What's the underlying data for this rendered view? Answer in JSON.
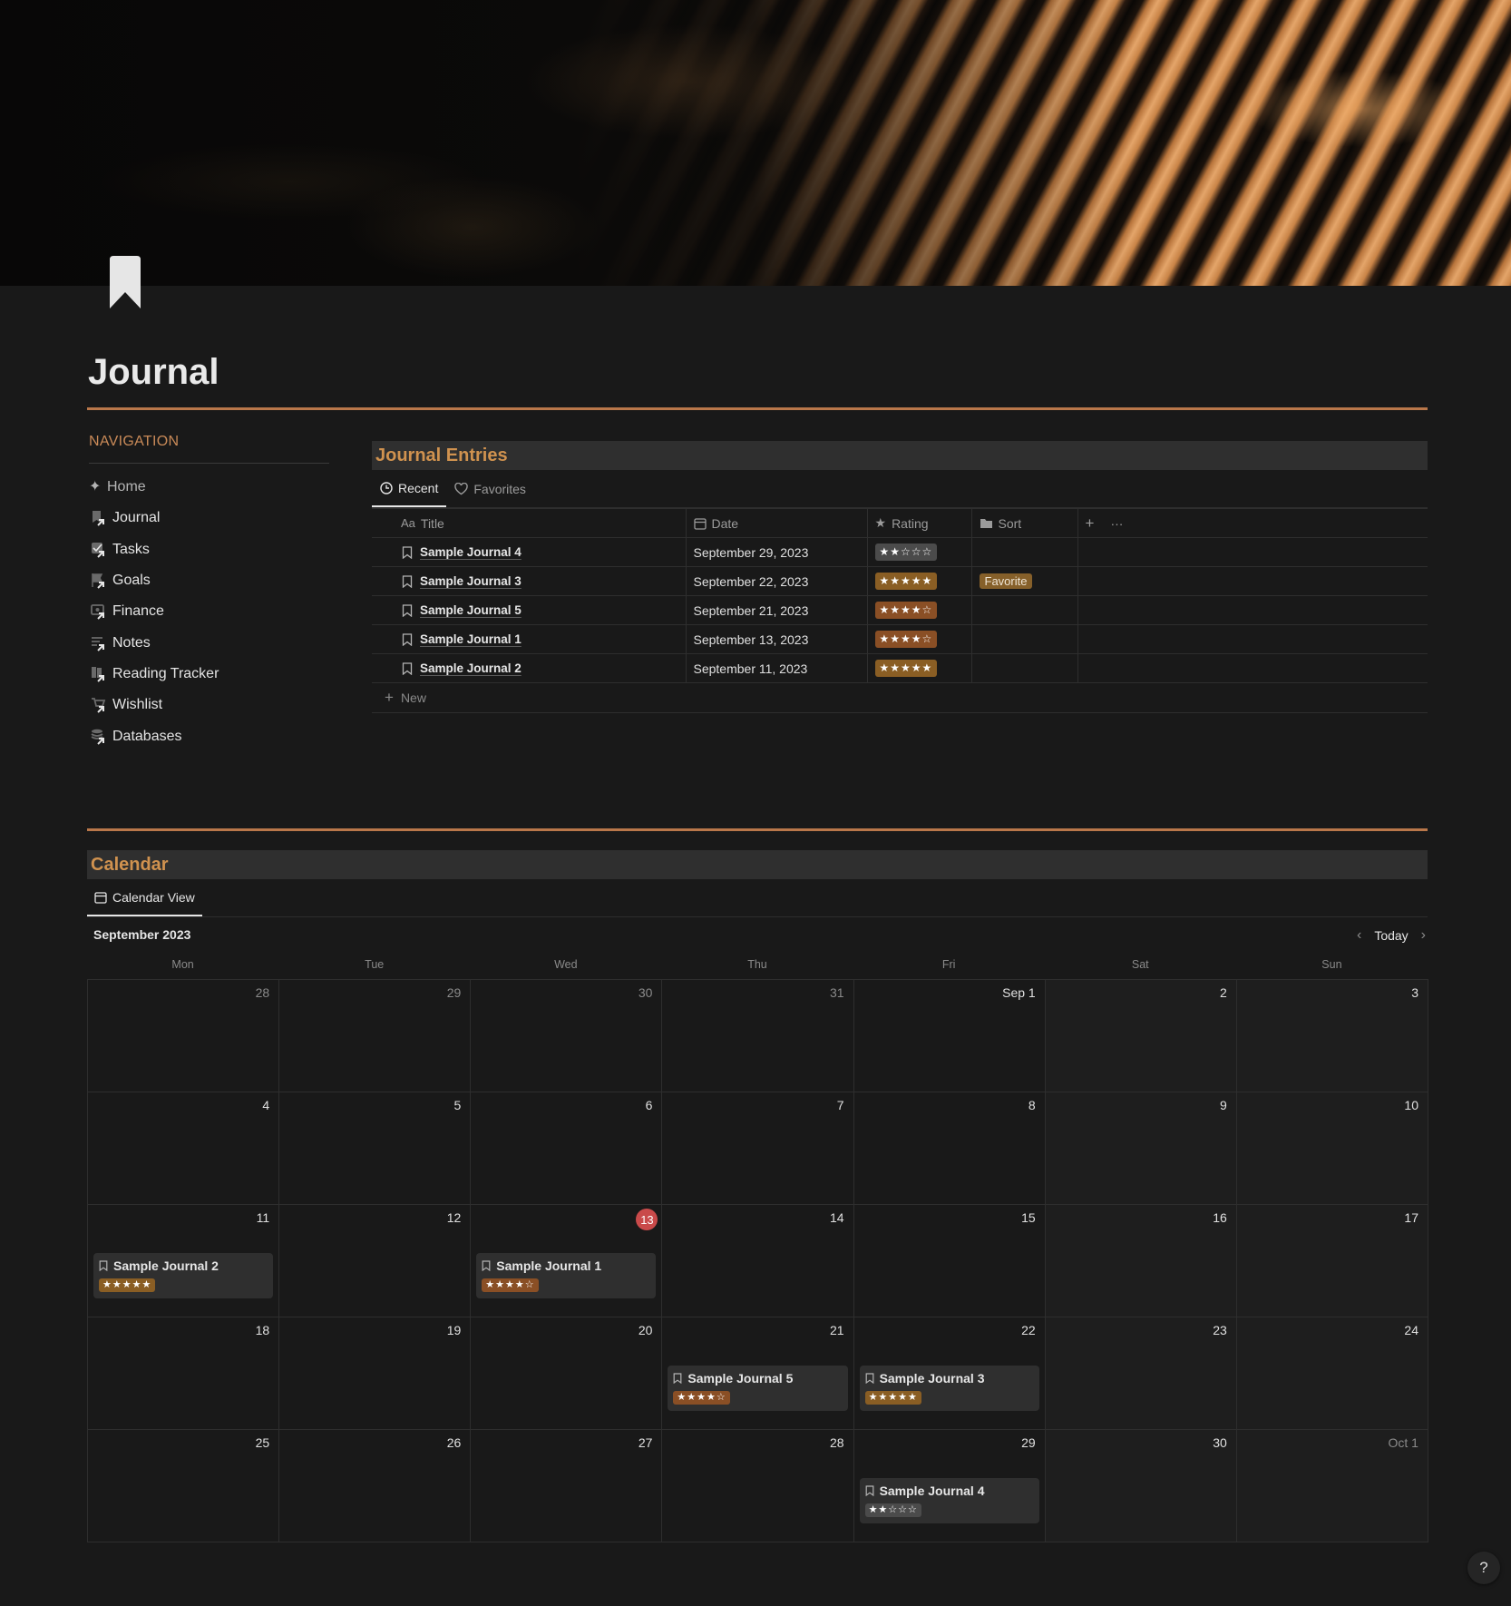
{
  "page": {
    "title": "Journal",
    "icon": "bookmark-icon"
  },
  "colors": {
    "accent": "#d0924f",
    "divider": "#b9774a",
    "background": "#191919",
    "today": "#c94a4a"
  },
  "navigation": {
    "header": "NAVIGATION",
    "items": [
      {
        "label": "Home",
        "icon": "sparkle-icon"
      },
      {
        "label": "Journal",
        "icon": "journal-link-icon"
      },
      {
        "label": "Tasks",
        "icon": "tasks-link-icon"
      },
      {
        "label": "Goals",
        "icon": "goals-link-icon"
      },
      {
        "label": "Finance",
        "icon": "finance-link-icon"
      },
      {
        "label": "Notes",
        "icon": "notes-link-icon"
      },
      {
        "label": "Reading Tracker",
        "icon": "reading-link-icon"
      },
      {
        "label": "Wishlist",
        "icon": "wishlist-link-icon"
      },
      {
        "label": "Databases",
        "icon": "databases-link-icon"
      }
    ]
  },
  "entries": {
    "title": "Journal Entries",
    "tabs": [
      {
        "label": "Recent",
        "icon": "clock-icon",
        "active": true
      },
      {
        "label": "Favorites",
        "icon": "heart-icon",
        "active": false
      }
    ],
    "columns": {
      "title": "Title",
      "date": "Date",
      "rating": "Rating",
      "sort": "Sort"
    },
    "rows": [
      {
        "title": "Sample Journal 4",
        "date": "September 29, 2023",
        "rating": "★★☆☆☆",
        "rating_value": 2,
        "sort": ""
      },
      {
        "title": "Sample Journal 3",
        "date": "September 22, 2023",
        "rating": "★★★★★",
        "rating_value": 5,
        "sort": "Favorite"
      },
      {
        "title": "Sample Journal 5",
        "date": "September 21, 2023",
        "rating": "★★★★☆",
        "rating_value": 4,
        "sort": ""
      },
      {
        "title": "Sample Journal 1",
        "date": "September 13, 2023",
        "rating": "★★★★☆",
        "rating_value": 4,
        "sort": ""
      },
      {
        "title": "Sample Journal 2",
        "date": "September 11, 2023",
        "rating": "★★★★★",
        "rating_value": 5,
        "sort": ""
      }
    ],
    "new_label": "New"
  },
  "calendar": {
    "title": "Calendar",
    "view_tab": "Calendar View",
    "month": "September 2023",
    "today_label": "Today",
    "weekdays": [
      "Mon",
      "Tue",
      "Wed",
      "Thu",
      "Fri",
      "Sat",
      "Sun"
    ],
    "days": [
      {
        "num": "28",
        "muted": true
      },
      {
        "num": "29",
        "muted": true
      },
      {
        "num": "30",
        "muted": true
      },
      {
        "num": "31",
        "muted": true
      },
      {
        "num": "Sep 1"
      },
      {
        "num": "2"
      },
      {
        "num": "3"
      },
      {
        "num": "4"
      },
      {
        "num": "5"
      },
      {
        "num": "6"
      },
      {
        "num": "7"
      },
      {
        "num": "8"
      },
      {
        "num": "9"
      },
      {
        "num": "10"
      },
      {
        "num": "11",
        "entry": {
          "title": "Sample Journal 2",
          "rating": "★★★★★",
          "rating_value": 5
        }
      },
      {
        "num": "12"
      },
      {
        "num": "13",
        "today": true,
        "entry": {
          "title": "Sample Journal 1",
          "rating": "★★★★☆",
          "rating_value": 4
        }
      },
      {
        "num": "14"
      },
      {
        "num": "15"
      },
      {
        "num": "16"
      },
      {
        "num": "17"
      },
      {
        "num": "18"
      },
      {
        "num": "19"
      },
      {
        "num": "20"
      },
      {
        "num": "21",
        "entry": {
          "title": "Sample Journal 5",
          "rating": "★★★★☆",
          "rating_value": 4
        }
      },
      {
        "num": "22",
        "entry": {
          "title": "Sample Journal 3",
          "rating": "★★★★★",
          "rating_value": 5
        }
      },
      {
        "num": "23"
      },
      {
        "num": "24"
      },
      {
        "num": "25"
      },
      {
        "num": "26"
      },
      {
        "num": "27"
      },
      {
        "num": "28"
      },
      {
        "num": "29",
        "entry": {
          "title": "Sample Journal 4",
          "rating": "★★☆☆☆",
          "rating_value": 2
        }
      },
      {
        "num": "30"
      },
      {
        "num": "Oct 1",
        "muted": true
      }
    ]
  },
  "help": {
    "label": "?"
  }
}
